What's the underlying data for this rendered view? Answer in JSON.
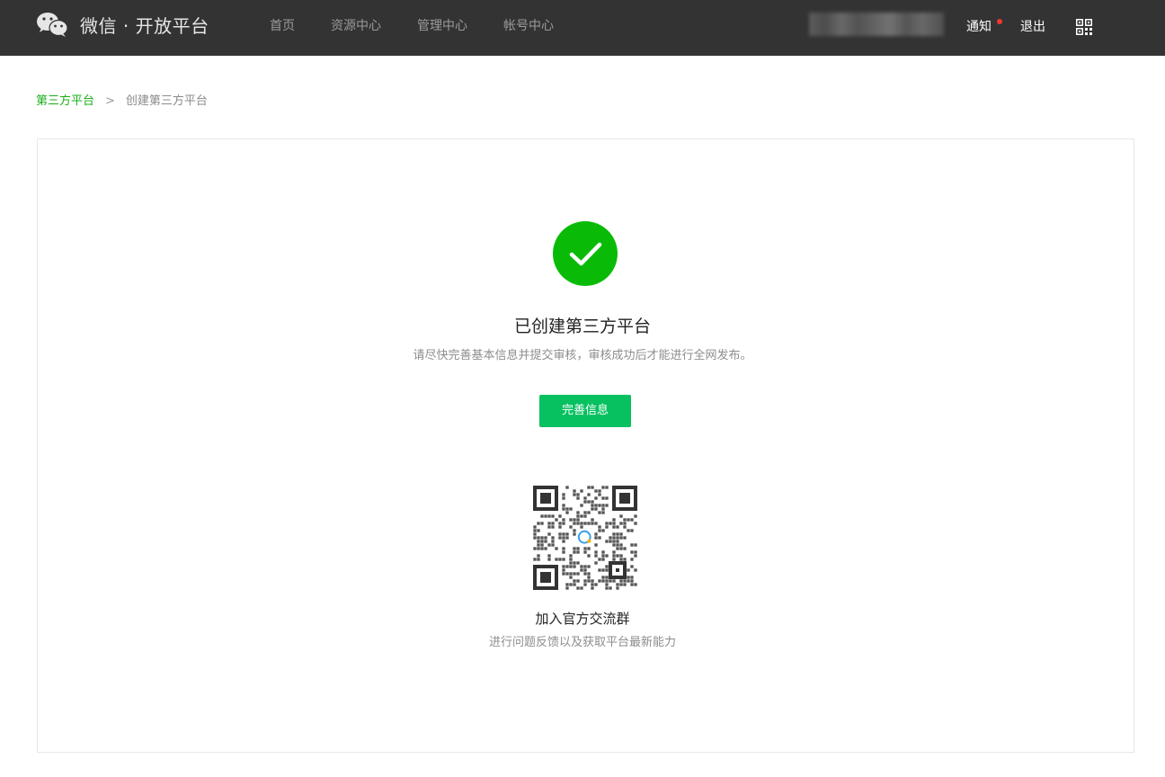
{
  "header": {
    "brand": "微信 · 开放平台",
    "nav": [
      {
        "label": "首页"
      },
      {
        "label": "资源中心"
      },
      {
        "label": "管理中心"
      },
      {
        "label": "帐号中心"
      }
    ],
    "notify_label": "通知",
    "logout_label": "退出",
    "icons": {
      "logo": "wechat-logo-icon",
      "qr": "qrcode-icon"
    },
    "colors": {
      "bar": "#333333",
      "notify_dot": "#f43530"
    }
  },
  "breadcrumb": {
    "parent": "第三方平台",
    "separator": ">",
    "current": "创建第三方平台"
  },
  "result": {
    "icon": "success-check-icon",
    "title": "已创建第三方平台",
    "description": "请尽快完善基本信息并提交审核，审核成功后才能进行全网发布。",
    "button_label": "完善信息",
    "colors": {
      "success": "#09bb07",
      "button": "#07c160",
      "link": "#1aad19"
    }
  },
  "community": {
    "title": "加入官方交流群",
    "description": "进行问题反馈以及获取平台最新能力"
  }
}
